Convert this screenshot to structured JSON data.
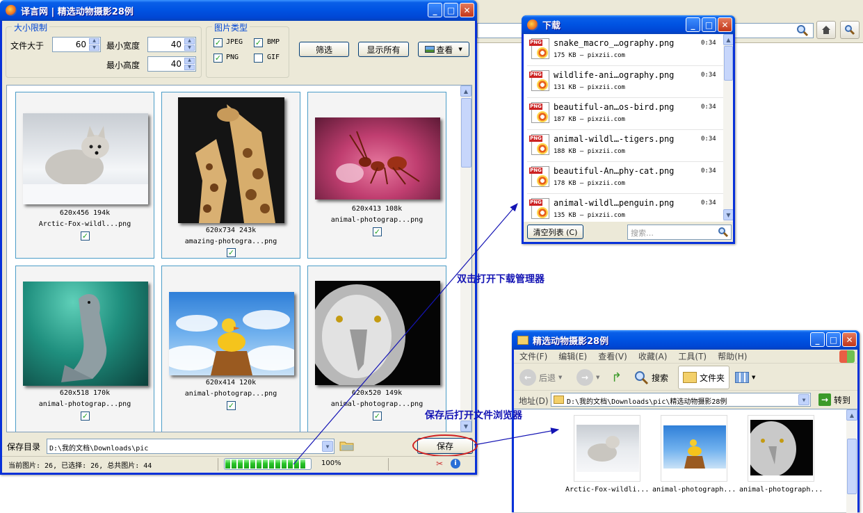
{
  "browser_bg": {
    "url": ""
  },
  "main_window": {
    "title": "译言网 | 精选动物摄影28例",
    "size_group": {
      "title": "大小限制",
      "file_size_label": "文件大于",
      "file_size_value": "60",
      "min_width_label": "最小宽度",
      "min_width_value": "40",
      "min_height_label": "最小高度",
      "min_height_value": "40"
    },
    "type_group": {
      "title": "图片类型",
      "types": [
        {
          "label": "JPEG",
          "checked": true
        },
        {
          "label": "BMP",
          "checked": true
        },
        {
          "label": "PNG",
          "checked": true
        },
        {
          "label": "GIF",
          "checked": false
        }
      ]
    },
    "buttons": {
      "filter": "筛选",
      "show_all": "显示所有",
      "view": "查看"
    },
    "images": [
      {
        "dims": "620x456 194k",
        "name": "Arctic-Fox-wildl...png",
        "checked": true
      },
      {
        "dims": "620x734 243k",
        "name": "amazing-photogra...png",
        "checked": true
      },
      {
        "dims": "620x413 108k",
        "name": "animal-photograp...png",
        "checked": true
      },
      {
        "dims": "620x518 170k",
        "name": "animal-photograp...png",
        "checked": true
      },
      {
        "dims": "620x414 120k",
        "name": "animal-photograp...png",
        "checked": true
      },
      {
        "dims": "620x520 149k",
        "name": "animal-photograp...png",
        "checked": true
      }
    ],
    "save_dir_label": "保存目录",
    "save_dir_value": "D:\\我的文档\\Downloads\\pic",
    "save_button": "保存",
    "status_text": "当前图片: 26, 已选择: 26, 总共图片: 44",
    "progress": 100,
    "progress_label": "100%"
  },
  "download_window": {
    "title": "下载",
    "items": [
      {
        "name": "snake_macro_…ography.png",
        "time": "0:34",
        "meta": "175 KB — pixzii.com"
      },
      {
        "name": "wildlife-ani…ography.png",
        "time": "0:34",
        "meta": "131 KB — pixzii.com"
      },
      {
        "name": "beautiful-an…os-bird.png",
        "time": "0:34",
        "meta": "187 KB — pixzii.com"
      },
      {
        "name": "animal-wildl…-tigers.png",
        "time": "0:34",
        "meta": "188 KB — pixzii.com"
      },
      {
        "name": "beautiful-An…phy-cat.png",
        "time": "0:34",
        "meta": "178 KB — pixzii.com"
      },
      {
        "name": "animal-wildl…penguin.png",
        "time": "0:34",
        "meta": "135 KB — pixzii.com"
      }
    ],
    "clear_button": "清空列表 (C)",
    "search_placeholder": "搜索…"
  },
  "annotations": {
    "double_click": "双击打开下载管理器",
    "after_save": "保存后打开文件浏览器"
  },
  "explorer_window": {
    "title": "精选动物摄影28例",
    "menu": [
      "文件(F)",
      "编辑(E)",
      "查看(V)",
      "收藏(A)",
      "工具(T)",
      "帮助(H)"
    ],
    "back_label": "后退",
    "search_label": "搜索",
    "folders_label": "文件夹",
    "address_label": "地址(D)",
    "address_value": "D:\\我的文档\\Downloads\\pic\\精选动物摄影28例",
    "go_label": "转到",
    "files": [
      "Arctic-Fox-wildli...",
      "animal-photograph...",
      "animal-photograph..."
    ]
  }
}
